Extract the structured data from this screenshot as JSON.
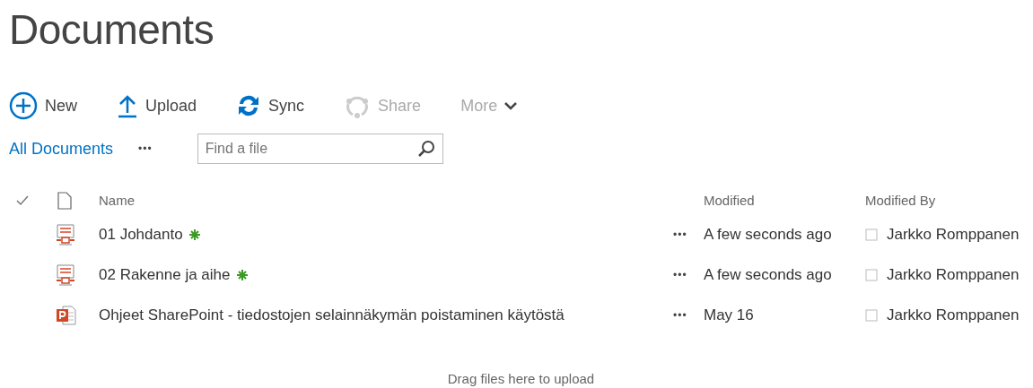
{
  "page_title": "Documents",
  "commands": [
    {
      "kind": "new",
      "label": "New",
      "disabled": false
    },
    {
      "kind": "upload",
      "label": "Upload",
      "disabled": false
    },
    {
      "kind": "sync",
      "label": "Sync",
      "disabled": false
    },
    {
      "kind": "share",
      "label": "Share",
      "disabled": true
    },
    {
      "kind": "more",
      "label": "More",
      "disabled": true
    }
  ],
  "view": {
    "label": "All Documents",
    "more": "•••"
  },
  "search": {
    "placeholder": "Find a file"
  },
  "table": {
    "columns": [
      "Name",
      "Modified",
      "Modified By"
    ],
    "rows": [
      {
        "kind": "pdf",
        "name": "01 Johdanto",
        "is_new": true,
        "menu": "•••",
        "modified": "A few seconds ago",
        "modified_by": "Jarkko Romppanen"
      },
      {
        "kind": "pdf",
        "name": "02 Rakenne ja aihe",
        "is_new": true,
        "menu": "•••",
        "modified": "A few seconds ago",
        "modified_by": "Jarkko Romppanen"
      },
      {
        "kind": "pptx",
        "name": "Ohjeet SharePoint - tiedostojen selainnäkymän poistaminen käytöstä",
        "is_new": false,
        "menu": "•••",
        "modified": "May 16",
        "modified_by": "Jarkko Romppanen"
      }
    ]
  },
  "drop_hint": "Drag files here to upload"
}
